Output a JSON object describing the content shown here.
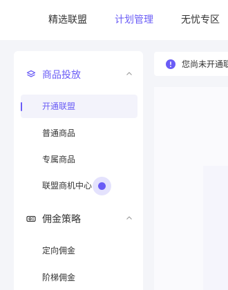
{
  "top_nav": {
    "tabs": [
      {
        "label": "精选联盟",
        "active": false
      },
      {
        "label": "计划管理",
        "active": true
      },
      {
        "label": "无忧专区",
        "active": false
      }
    ]
  },
  "sidebar": {
    "groups": [
      {
        "label": "商品投放",
        "icon": "layers-icon",
        "expanded": true,
        "items": [
          {
            "label": "开通联盟",
            "active": true
          },
          {
            "label": "普通商品",
            "active": false
          },
          {
            "label": "专属商品",
            "active": false
          },
          {
            "label": "联盟商机中心",
            "active": false
          }
        ]
      },
      {
        "label": "佣金策略",
        "icon": "ticket-icon",
        "expanded": true,
        "items": [
          {
            "label": "定向佣金",
            "active": false
          },
          {
            "label": "阶梯佣金",
            "active": false
          }
        ]
      }
    ]
  },
  "notice": {
    "icon": "info-icon",
    "text": "您尚未开通联盟"
  },
  "colors": {
    "accent": "#6a5cf6",
    "text": "#333333",
    "background": "#f4f5f9",
    "active_item_bg": "#f3f3fb"
  }
}
